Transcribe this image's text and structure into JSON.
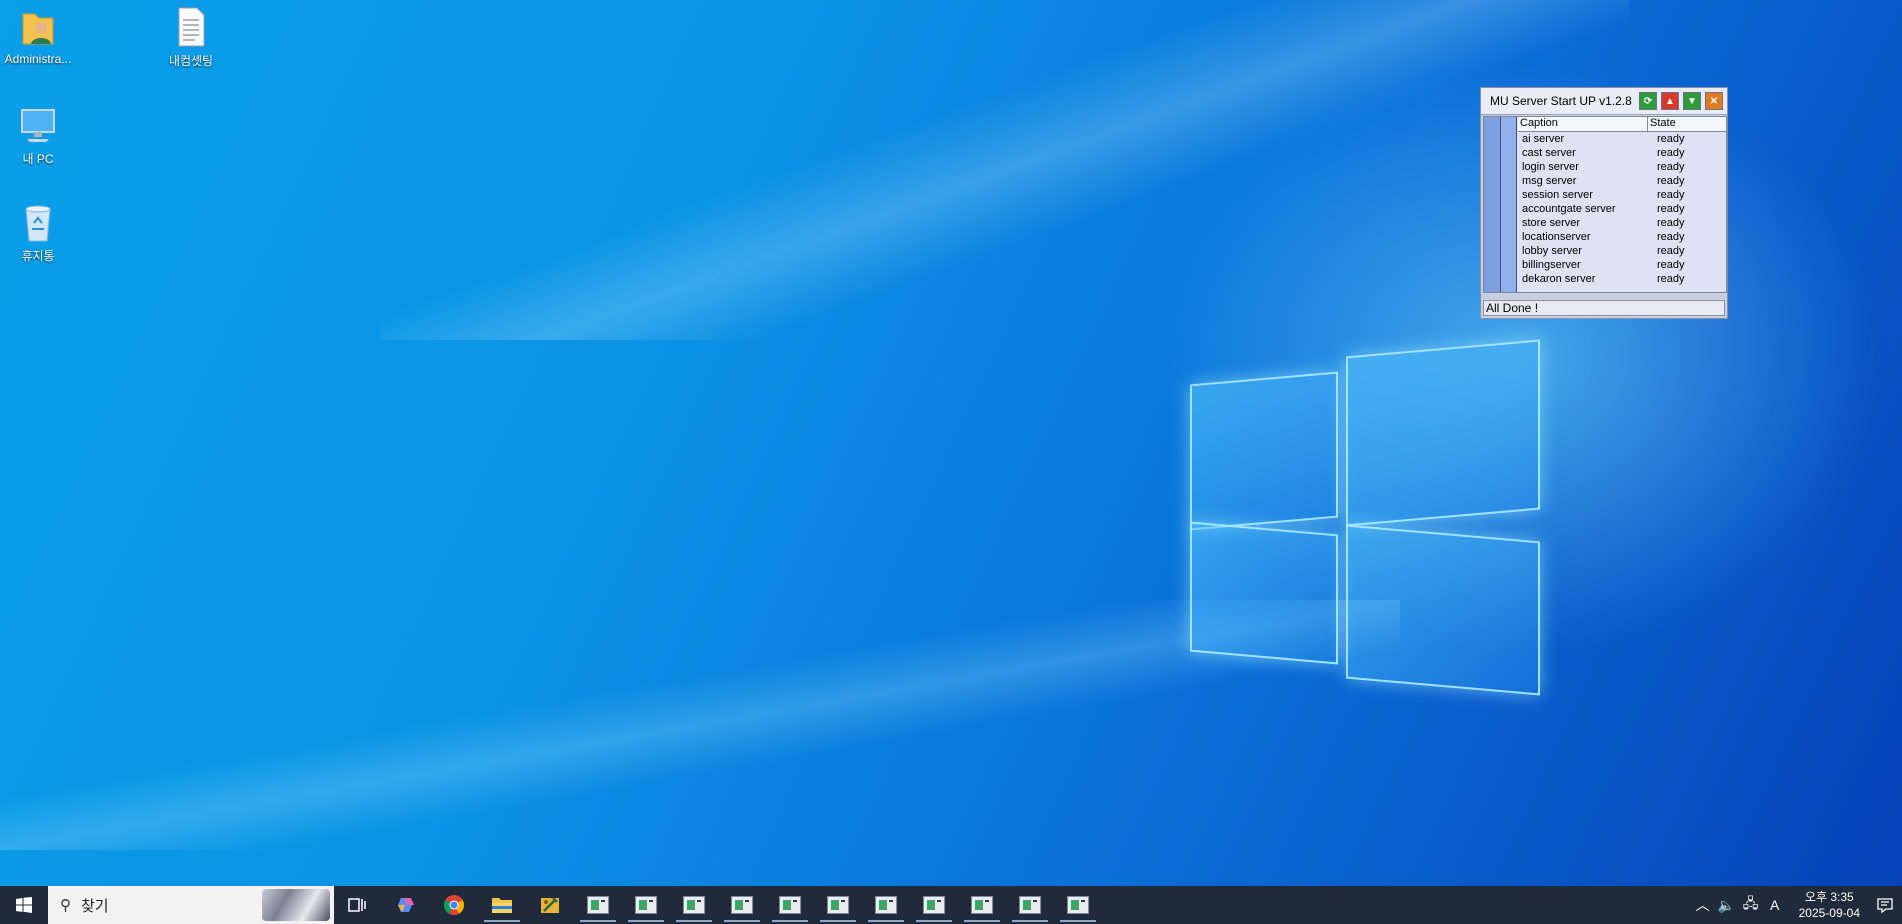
{
  "desktop": {
    "icons": [
      {
        "label": "Administra...",
        "icon": "user-folder-icon"
      },
      {
        "label": "내컴셋팅",
        "icon": "text-document-icon"
      },
      {
        "label": "내 PC",
        "icon": "computer-icon"
      },
      {
        "label": "휴지통",
        "icon": "recycle-bin-icon"
      }
    ]
  },
  "app_window": {
    "title": "MU Server Start UP v1.2.8",
    "buttons": [
      {
        "name": "refresh",
        "icon": "refresh-icon",
        "color": "#2e9a3a"
      },
      {
        "name": "up",
        "icon": "arrow-up-icon",
        "color": "#d63a2a"
      },
      {
        "name": "down",
        "icon": "arrow-down-icon",
        "color": "#2e9a3a"
      },
      {
        "name": "close",
        "icon": "close-icon",
        "color": "#e07a1a"
      }
    ],
    "columns": [
      "Caption",
      "State"
    ],
    "rows": [
      {
        "caption": "ai server",
        "state": "ready"
      },
      {
        "caption": "cast server",
        "state": "ready"
      },
      {
        "caption": "login server",
        "state": "ready"
      },
      {
        "caption": "msg server",
        "state": "ready"
      },
      {
        "caption": "session server",
        "state": "ready"
      },
      {
        "caption": "accountgate server",
        "state": "ready"
      },
      {
        "caption": "store server",
        "state": "ready"
      },
      {
        "caption": "locationserver",
        "state": "ready"
      },
      {
        "caption": "lobby server",
        "state": "ready"
      },
      {
        "caption": "billingserver",
        "state": "ready"
      },
      {
        "caption": "dekaron server",
        "state": "ready"
      }
    ],
    "status_text": "All Done !"
  },
  "taskbar": {
    "search_placeholder": "찾기",
    "pinned": [
      "task-view-icon",
      "copilot-icon",
      "chrome-icon",
      "file-explorer-icon",
      "tools-icon"
    ],
    "open_app_count": 11,
    "tray": {
      "ime": "A",
      "time": "오후 3:35",
      "date": "2025-09-04"
    }
  },
  "colors": {
    "taskbar_bg": "#1f2a3a",
    "wallpaper_blue": "#0a8fe6"
  }
}
